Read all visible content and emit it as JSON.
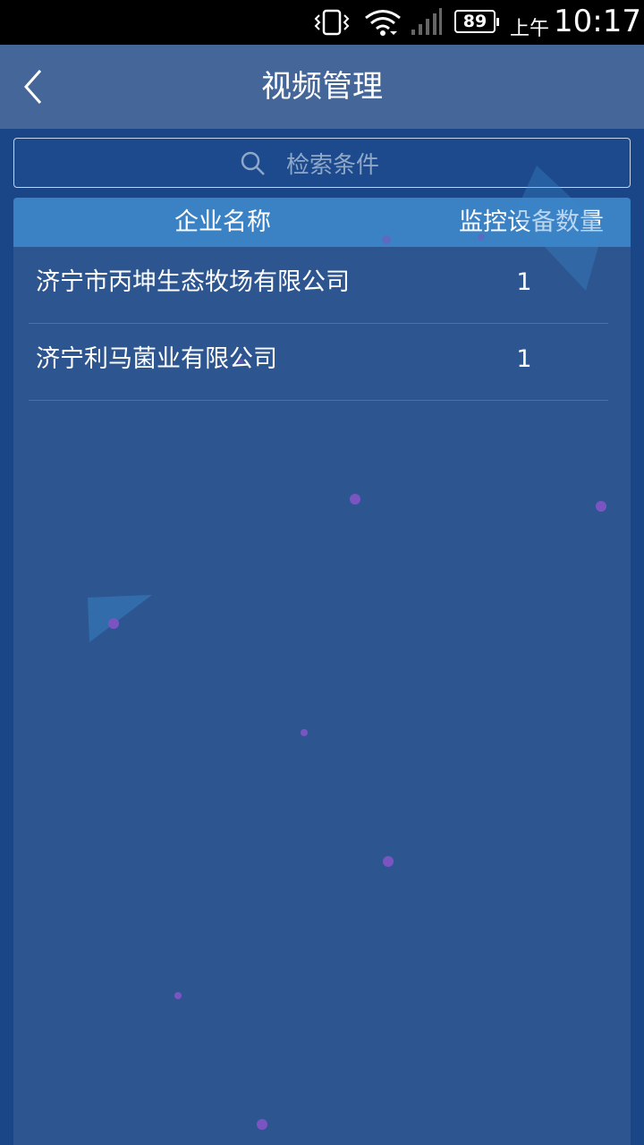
{
  "status_bar": {
    "battery_level": "89",
    "ampm": "上午",
    "time": "10:17",
    "icons": [
      "vibrate-icon",
      "wifi-icon",
      "signal-icon",
      "battery-icon"
    ]
  },
  "header": {
    "back_icon": "chevron-left-icon",
    "title": "视频管理"
  },
  "search": {
    "placeholder": "检索条件",
    "icon": "search-icon"
  },
  "table": {
    "columns": [
      "企业名称",
      "监控设备数量"
    ],
    "rows": [
      {
        "name": "济宁市丙坤生态牧场有限公司",
        "count": "1"
      },
      {
        "name": "济宁利马菌业有限公司",
        "count": "1"
      }
    ]
  },
  "colors": {
    "status_bar": "#000000",
    "header": "#446698",
    "background": "#1a4586",
    "panel": "#2d5690",
    "table_header": "#3b82c4"
  }
}
